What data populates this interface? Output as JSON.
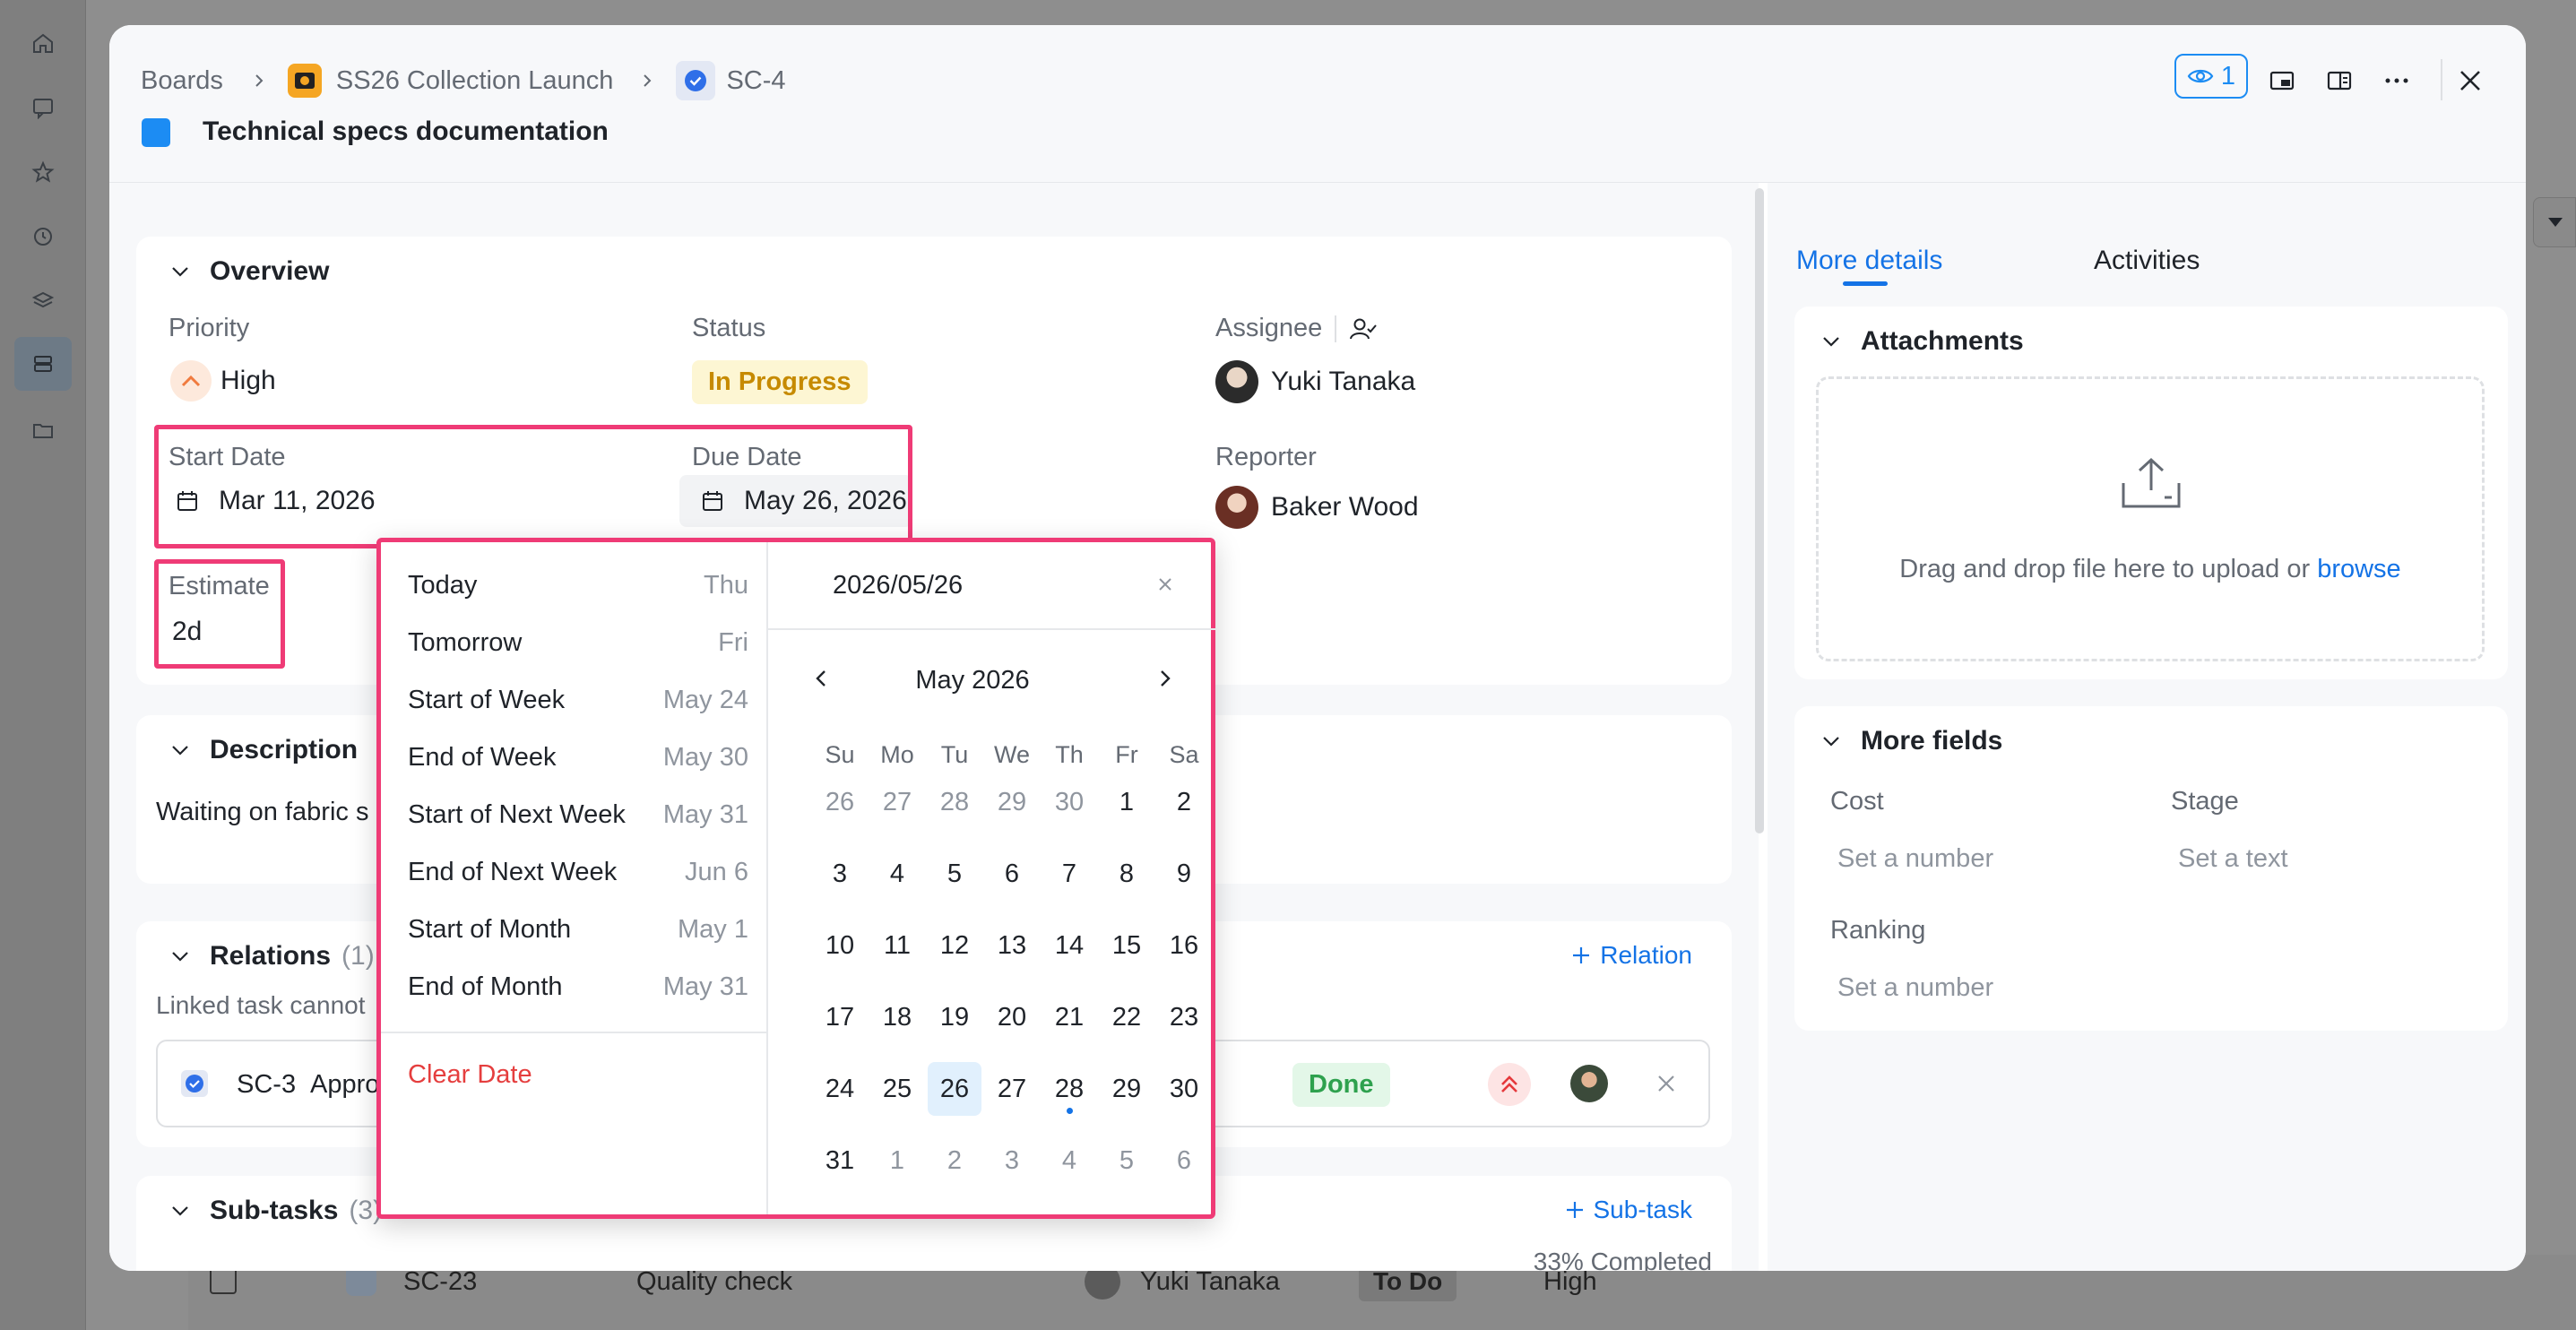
{
  "breadcrumb": {
    "boards": "Boards",
    "project": "SS26 Collection Launch",
    "task_key": "SC-4"
  },
  "task_title": "Technical specs documentation",
  "toolbar": {
    "watchers_count": "1"
  },
  "overview": {
    "section_title": "Overview",
    "priority_label": "Priority",
    "priority_value": "High",
    "status_label": "Status",
    "status_value": "In Progress",
    "assignee_label": "Assignee",
    "assignee_value": "Yuki Tanaka",
    "start_date_label": "Start Date",
    "start_date_value": "Mar 11, 2026",
    "due_date_label": "Due Date",
    "due_date_value": "May 26, 2026",
    "reporter_label": "Reporter",
    "reporter_value": "Baker Wood",
    "estimate_label": "Estimate",
    "estimate_value": "2d"
  },
  "description": {
    "section_title": "Description",
    "text": "Waiting on fabric s"
  },
  "relations": {
    "section_title": "Relations",
    "count": "(1)",
    "add_label": "Relation",
    "note": "Linked task cannot",
    "item": {
      "key": "SC-3",
      "title": "Appro",
      "status": "Done"
    }
  },
  "subtasks": {
    "section_title": "Sub-tasks",
    "count": "(3)",
    "add_label": "Sub-task",
    "progress_text": "33% Completed",
    "progress": 0.33
  },
  "background_row": {
    "key": "SC-23",
    "title": "Quality check",
    "assignee": "Yuki Tanaka",
    "status": "To Do",
    "priority": "High"
  },
  "right_panel": {
    "tabs": [
      "More details",
      "Activities"
    ],
    "active_tab": "More details",
    "attachments_title": "Attachments",
    "upload_text": "Drag and drop file here to upload or",
    "upload_link": "browse",
    "more_fields_title": "More fields",
    "cost_label": "Cost",
    "cost_placeholder": "Set a number",
    "stage_label": "Stage",
    "stage_placeholder": "Set a text",
    "ranking_label": "Ranking",
    "ranking_placeholder": "Set a number"
  },
  "date_picker": {
    "input_value": "2026/05/26",
    "month_label": "May 2026",
    "weekdays": [
      "Su",
      "Mo",
      "Tu",
      "We",
      "Th",
      "Fr",
      "Sa"
    ],
    "quick_options": [
      {
        "label": "Today",
        "date": "Thu"
      },
      {
        "label": "Tomorrow",
        "date": "Fri"
      },
      {
        "label": "Start of Week",
        "date": "May 24"
      },
      {
        "label": "End of Week",
        "date": "May 30"
      },
      {
        "label": "Start of Next Week",
        "date": "May 31"
      },
      {
        "label": "End of Next Week",
        "date": "Jun 6"
      },
      {
        "label": "Start of Month",
        "date": "May 1"
      },
      {
        "label": "End of Month",
        "date": "May 31"
      }
    ],
    "clear_label": "Clear Date",
    "days": [
      [
        {
          "d": "26",
          "o": true
        },
        {
          "d": "27",
          "o": true
        },
        {
          "d": "28",
          "o": true
        },
        {
          "d": "29",
          "o": true
        },
        {
          "d": "30",
          "o": true
        },
        {
          "d": "1"
        },
        {
          "d": "2"
        }
      ],
      [
        {
          "d": "3"
        },
        {
          "d": "4"
        },
        {
          "d": "5"
        },
        {
          "d": "6"
        },
        {
          "d": "7"
        },
        {
          "d": "8"
        },
        {
          "d": "9"
        }
      ],
      [
        {
          "d": "10"
        },
        {
          "d": "11"
        },
        {
          "d": "12"
        },
        {
          "d": "13"
        },
        {
          "d": "14"
        },
        {
          "d": "15"
        },
        {
          "d": "16"
        }
      ],
      [
        {
          "d": "17"
        },
        {
          "d": "18"
        },
        {
          "d": "19"
        },
        {
          "d": "20"
        },
        {
          "d": "21"
        },
        {
          "d": "22"
        },
        {
          "d": "23"
        }
      ],
      [
        {
          "d": "24"
        },
        {
          "d": "25"
        },
        {
          "d": "26",
          "sel": true
        },
        {
          "d": "27"
        },
        {
          "d": "28",
          "today": true
        },
        {
          "d": "29"
        },
        {
          "d": "30"
        }
      ],
      [
        {
          "d": "31"
        },
        {
          "d": "1",
          "o": true
        },
        {
          "d": "2",
          "o": true
        },
        {
          "d": "3",
          "o": true
        },
        {
          "d": "4",
          "o": true
        },
        {
          "d": "5",
          "o": true
        },
        {
          "d": "6",
          "o": true
        }
      ]
    ]
  },
  "colors": {
    "accent": "#1473e6",
    "highlight": "#ef3b76",
    "status_in_progress_bg": "#fdf6d3",
    "status_in_progress_text": "#c68a00",
    "status_done_bg": "#e3f7e8",
    "status_done_text": "#2ea14e",
    "clear_text": "#e53e3e"
  }
}
